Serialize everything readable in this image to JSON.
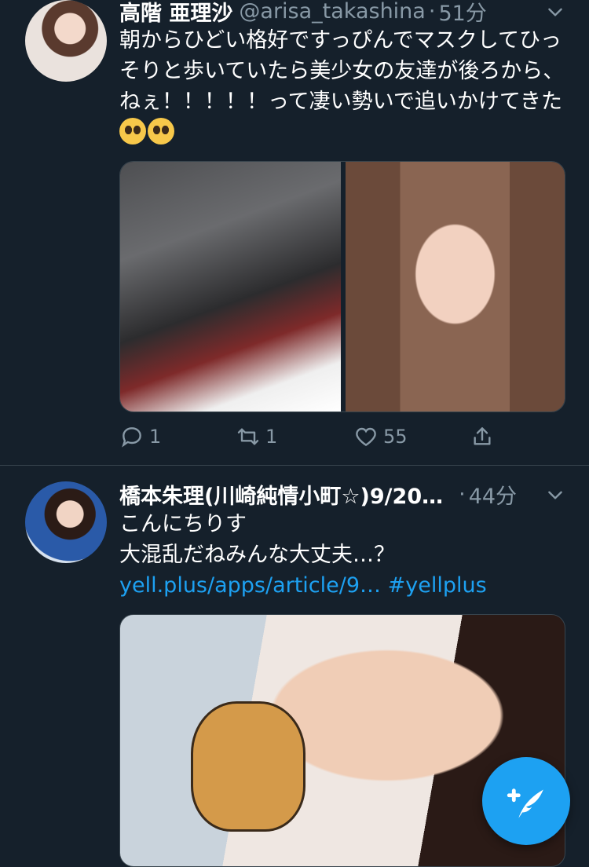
{
  "tweets": [
    {
      "name": "高階 亜理沙",
      "handle": "@arisa_takashina",
      "dot": "·",
      "time": "51分",
      "text": "朝からひどい格好ですっぴんでマスクしてひっそりと歩いていたら美少女の友達が後ろから、ねぇ！！！！！って凄い勢いで追いかけてきた",
      "emoji_count": 2,
      "reply_count": "1",
      "retweet_count": "1",
      "like_count": "55"
    },
    {
      "name": "橋本朱理(川崎純情小町☆)9/20…",
      "dot": "·",
      "time": "44分",
      "text_line1": "こんにちりす",
      "text_line2": "大混乱だねみんな大丈夫…？",
      "link": "yell.plus/apps/article/9…",
      "hashtag": "#yellplus"
    }
  ],
  "colors": {
    "background": "#15202b",
    "accent": "#1da1f2",
    "secondary_text": "#8899a6",
    "divider": "#38444d"
  },
  "icons": [
    "reply-icon",
    "retweet-icon",
    "like-icon",
    "share-icon",
    "chevron-down-icon",
    "compose-tweet-icon"
  ]
}
